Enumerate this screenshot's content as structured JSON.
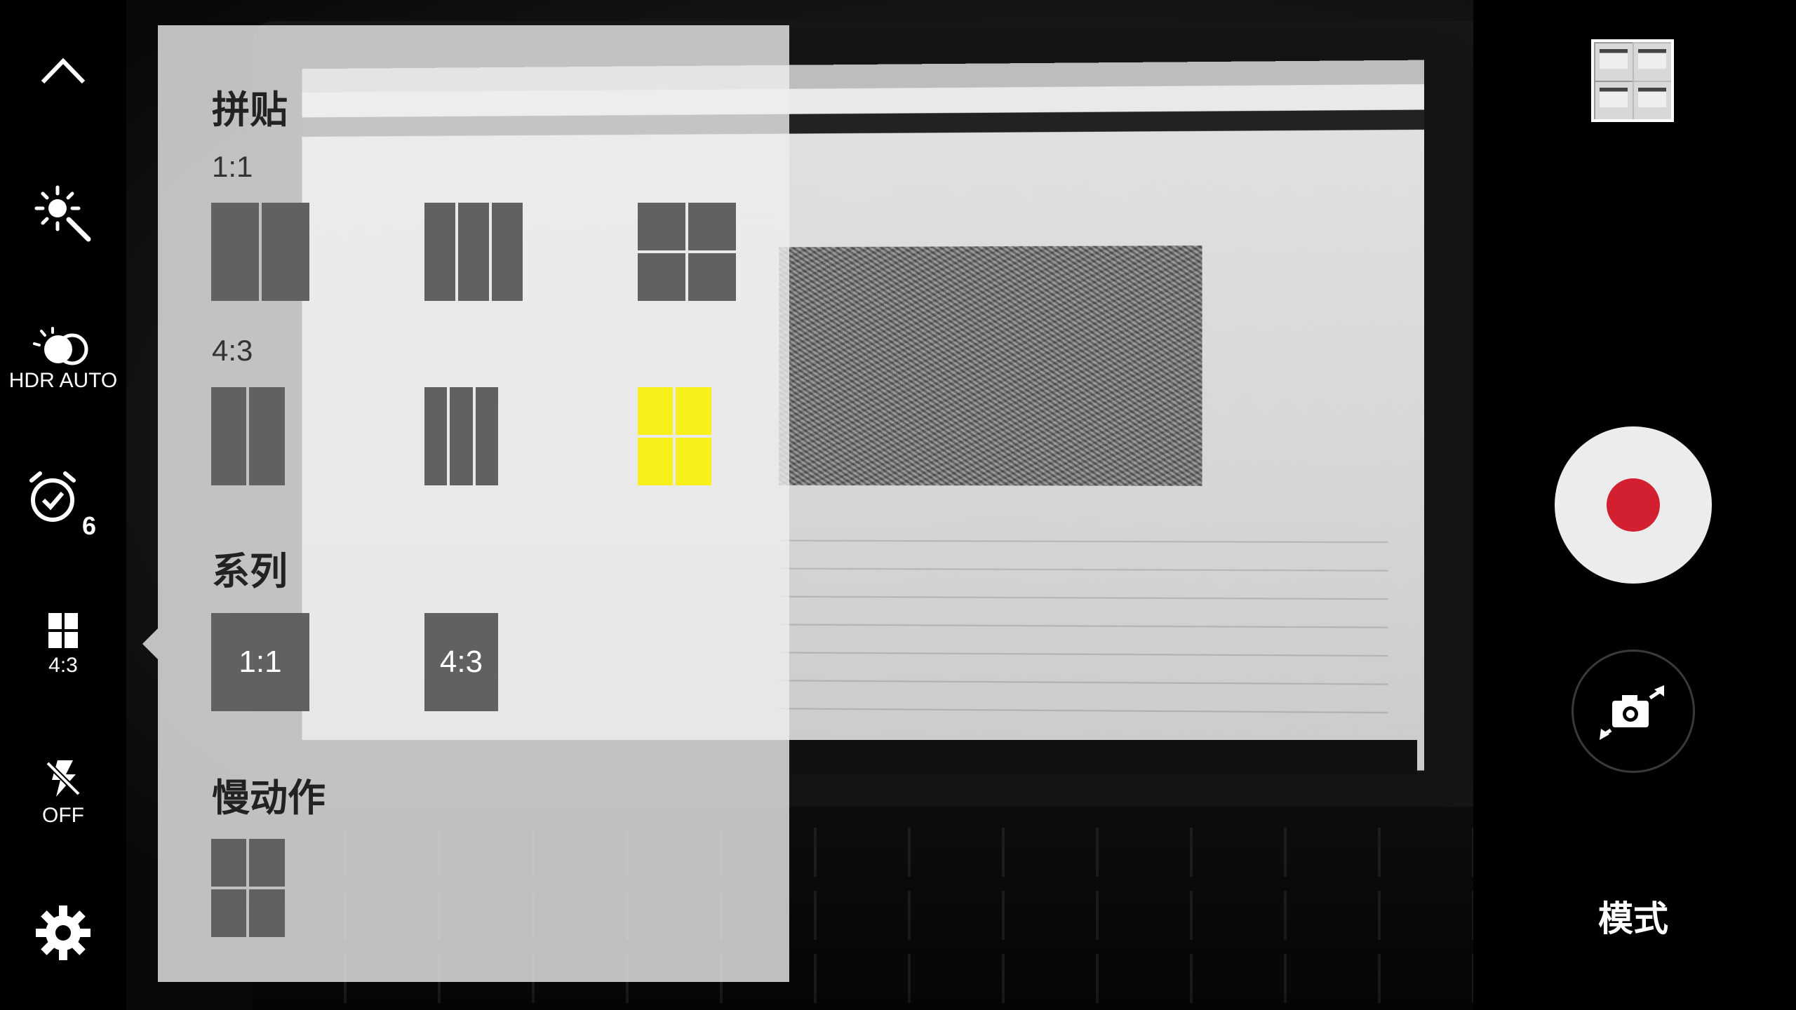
{
  "left_rail": {
    "collapse": {
      "icon": "chevron-up-icon"
    },
    "effects": {
      "icon": "magic-wand-icon"
    },
    "hdr": {
      "icon": "hdr-icon",
      "label": "HDR AUTO"
    },
    "timer": {
      "icon": "timer-icon",
      "value": "6"
    },
    "collage_mode": {
      "icon": "collage-grid-icon",
      "label": "4:3"
    },
    "flash": {
      "icon": "flash-off-icon",
      "label": "OFF"
    },
    "settings": {
      "icon": "gear-icon"
    }
  },
  "options_panel": {
    "collage": {
      "title": "拼贴",
      "ratio_1_1": {
        "label": "1:1",
        "layouts": [
          "two-vertical",
          "three-vertical",
          "four-grid"
        ]
      },
      "ratio_4_3": {
        "label": "4:3",
        "layouts": [
          "two-vertical",
          "three-vertical",
          "four-grid"
        ],
        "selected": "four-grid"
      }
    },
    "series": {
      "title": "系列",
      "options": [
        "1:1",
        "4:3"
      ]
    },
    "slow_motion": {
      "title": "慢动作",
      "layouts": [
        "four-grid"
      ]
    }
  },
  "right_rail": {
    "gallery": {
      "icon": "gallery-thumbnail"
    },
    "record": {
      "icon": "record-icon"
    },
    "switch_camera": {
      "icon": "switch-camera-icon"
    },
    "mode_label": "模式"
  },
  "colors": {
    "panel_bg": "#eeeeee",
    "layout_cell": "#616161",
    "selected_cell": "#f8f01a",
    "record_red": "#d32030"
  }
}
